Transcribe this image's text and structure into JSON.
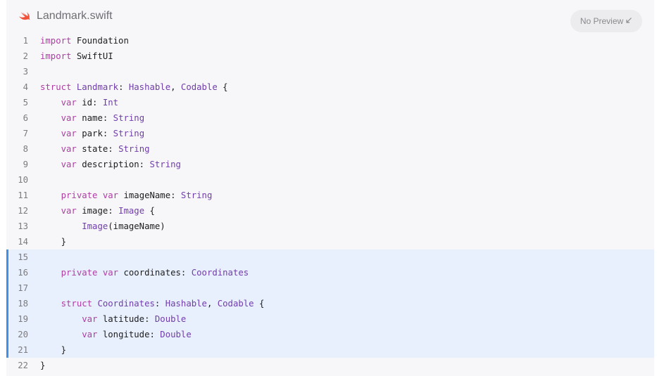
{
  "file": {
    "name": "Landmark.swift",
    "icon": "swift-logo-icon",
    "accent": "#f05138"
  },
  "preview_button": {
    "label": "No Preview",
    "icon": "arrow-down-left-icon"
  },
  "colors": {
    "keyword": "#ad3da4",
    "type": "#703daa",
    "plain": "#1d1d1f",
    "highlight_bg": "#e8f0fd",
    "highlight_marker": "#3f8ee8"
  },
  "code": {
    "highlight_lines": [
      15,
      16,
      17,
      18,
      19,
      20,
      21
    ],
    "lines": [
      {
        "n": "1",
        "tokens": [
          {
            "t": "import",
            "k": "kw"
          },
          {
            "t": " Foundation",
            "k": "pl"
          }
        ]
      },
      {
        "n": "2",
        "tokens": [
          {
            "t": "import",
            "k": "kw"
          },
          {
            "t": " SwiftUI",
            "k": "pl"
          }
        ]
      },
      {
        "n": "3",
        "tokens": []
      },
      {
        "n": "4",
        "tokens": [
          {
            "t": "struct",
            "k": "kw"
          },
          {
            "t": " ",
            "k": "pl"
          },
          {
            "t": "Landmark",
            "k": "ty"
          },
          {
            "t": ": ",
            "k": "pl"
          },
          {
            "t": "Hashable",
            "k": "ty"
          },
          {
            "t": ", ",
            "k": "pl"
          },
          {
            "t": "Codable",
            "k": "ty"
          },
          {
            "t": " {",
            "k": "pl"
          }
        ]
      },
      {
        "n": "5",
        "tokens": [
          {
            "t": "    ",
            "k": "pl"
          },
          {
            "t": "var",
            "k": "kw"
          },
          {
            "t": " id: ",
            "k": "pl"
          },
          {
            "t": "Int",
            "k": "ty"
          }
        ]
      },
      {
        "n": "6",
        "tokens": [
          {
            "t": "    ",
            "k": "pl"
          },
          {
            "t": "var",
            "k": "kw"
          },
          {
            "t": " name: ",
            "k": "pl"
          },
          {
            "t": "String",
            "k": "ty"
          }
        ]
      },
      {
        "n": "7",
        "tokens": [
          {
            "t": "    ",
            "k": "pl"
          },
          {
            "t": "var",
            "k": "kw"
          },
          {
            "t": " park: ",
            "k": "pl"
          },
          {
            "t": "String",
            "k": "ty"
          }
        ]
      },
      {
        "n": "8",
        "tokens": [
          {
            "t": "    ",
            "k": "pl"
          },
          {
            "t": "var",
            "k": "kw"
          },
          {
            "t": " state: ",
            "k": "pl"
          },
          {
            "t": "String",
            "k": "ty"
          }
        ]
      },
      {
        "n": "9",
        "tokens": [
          {
            "t": "    ",
            "k": "pl"
          },
          {
            "t": "var",
            "k": "kw"
          },
          {
            "t": " description: ",
            "k": "pl"
          },
          {
            "t": "String",
            "k": "ty"
          }
        ]
      },
      {
        "n": "10",
        "tokens": []
      },
      {
        "n": "11",
        "tokens": [
          {
            "t": "    ",
            "k": "pl"
          },
          {
            "t": "private",
            "k": "kw"
          },
          {
            "t": " ",
            "k": "pl"
          },
          {
            "t": "var",
            "k": "kw"
          },
          {
            "t": " imageName: ",
            "k": "pl"
          },
          {
            "t": "String",
            "k": "ty"
          }
        ]
      },
      {
        "n": "12",
        "tokens": [
          {
            "t": "    ",
            "k": "pl"
          },
          {
            "t": "var",
            "k": "kw"
          },
          {
            "t": " image: ",
            "k": "pl"
          },
          {
            "t": "Image",
            "k": "ty"
          },
          {
            "t": " {",
            "k": "pl"
          }
        ]
      },
      {
        "n": "13",
        "tokens": [
          {
            "t": "        ",
            "k": "pl"
          },
          {
            "t": "Image",
            "k": "ty"
          },
          {
            "t": "(imageName)",
            "k": "pl"
          }
        ]
      },
      {
        "n": "14",
        "tokens": [
          {
            "t": "    }",
            "k": "pl"
          }
        ]
      },
      {
        "n": "15",
        "tokens": []
      },
      {
        "n": "16",
        "tokens": [
          {
            "t": "    ",
            "k": "pl"
          },
          {
            "t": "private",
            "k": "kw"
          },
          {
            "t": " ",
            "k": "pl"
          },
          {
            "t": "var",
            "k": "kw"
          },
          {
            "t": " coordinates: ",
            "k": "pl"
          },
          {
            "t": "Coordinates",
            "k": "ty"
          }
        ]
      },
      {
        "n": "17",
        "tokens": []
      },
      {
        "n": "18",
        "tokens": [
          {
            "t": "    ",
            "k": "pl"
          },
          {
            "t": "struct",
            "k": "kw"
          },
          {
            "t": " ",
            "k": "pl"
          },
          {
            "t": "Coordinates",
            "k": "ty"
          },
          {
            "t": ": ",
            "k": "pl"
          },
          {
            "t": "Hashable",
            "k": "ty"
          },
          {
            "t": ", ",
            "k": "pl"
          },
          {
            "t": "Codable",
            "k": "ty"
          },
          {
            "t": " {",
            "k": "pl"
          }
        ]
      },
      {
        "n": "19",
        "tokens": [
          {
            "t": "        ",
            "k": "pl"
          },
          {
            "t": "var",
            "k": "kw"
          },
          {
            "t": " latitude: ",
            "k": "pl"
          },
          {
            "t": "Double",
            "k": "ty"
          }
        ]
      },
      {
        "n": "20",
        "tokens": [
          {
            "t": "        ",
            "k": "pl"
          },
          {
            "t": "var",
            "k": "kw"
          },
          {
            "t": " longitude: ",
            "k": "pl"
          },
          {
            "t": "Double",
            "k": "ty"
          }
        ]
      },
      {
        "n": "21",
        "tokens": [
          {
            "t": "    }",
            "k": "pl"
          }
        ]
      },
      {
        "n": "22",
        "tokens": [
          {
            "t": "}",
            "k": "pl"
          }
        ]
      }
    ]
  }
}
